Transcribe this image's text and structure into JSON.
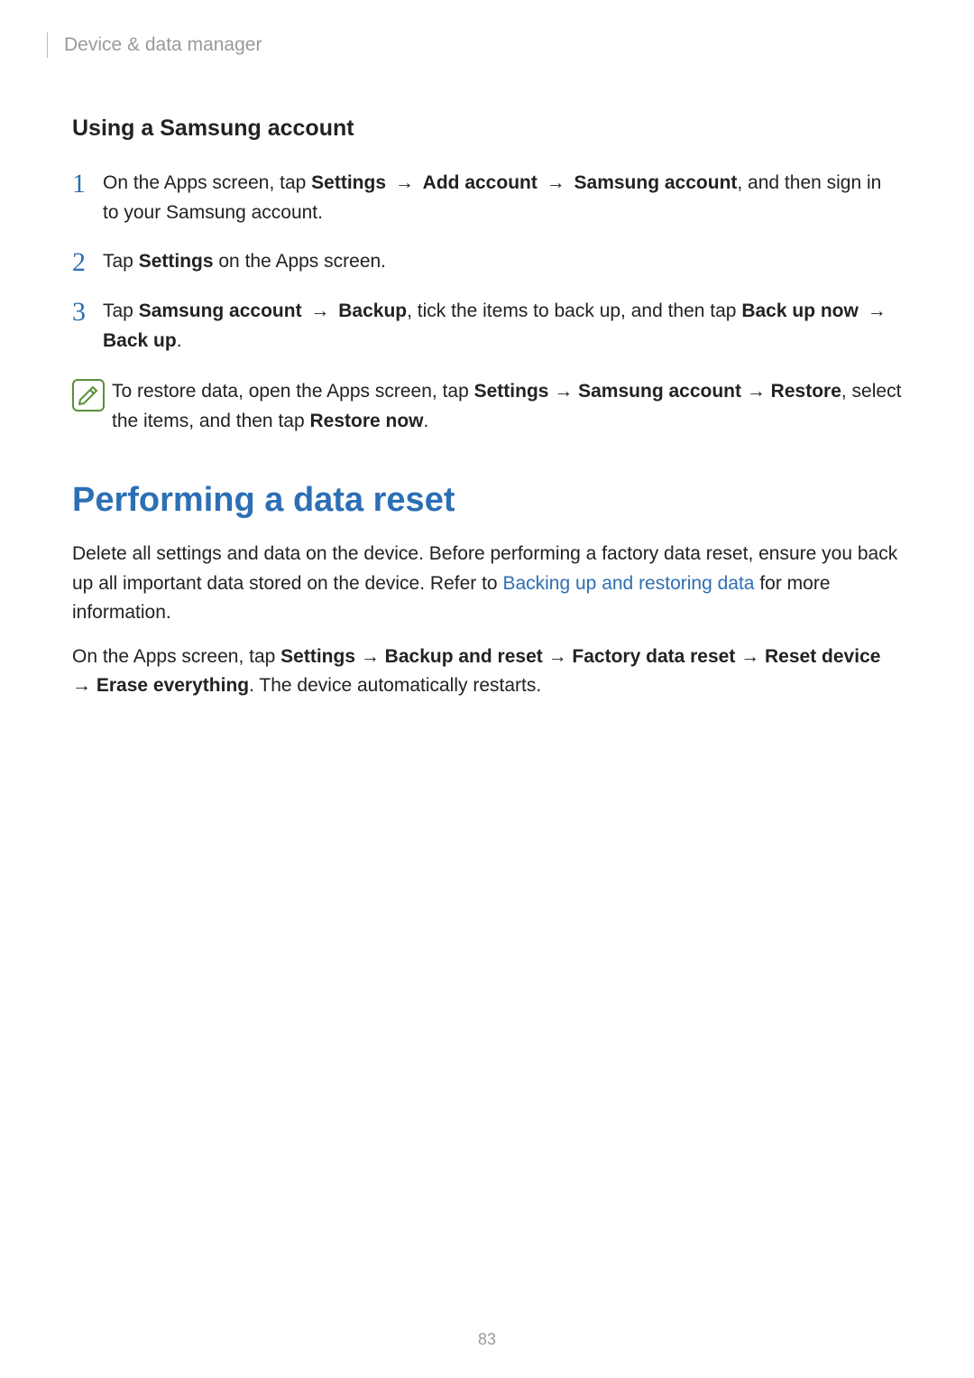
{
  "header": {
    "breadcrumb": "Device & data manager"
  },
  "section1": {
    "heading": "Using a Samsung account",
    "steps": [
      {
        "num": "1",
        "parts": [
          {
            "t": "On the Apps screen, tap "
          },
          {
            "t": "Settings",
            "b": true
          },
          {
            "t": " → ",
            "arrow": true
          },
          {
            "t": "Add account",
            "b": true
          },
          {
            "t": " → ",
            "arrow": true
          },
          {
            "t": "Samsung account",
            "b": true
          },
          {
            "t": ", and then sign in to your Samsung account."
          }
        ]
      },
      {
        "num": "2",
        "parts": [
          {
            "t": "Tap "
          },
          {
            "t": "Settings",
            "b": true
          },
          {
            "t": " on the Apps screen."
          }
        ]
      },
      {
        "num": "3",
        "parts": [
          {
            "t": "Tap "
          },
          {
            "t": "Samsung account",
            "b": true
          },
          {
            "t": " → ",
            "arrow": true
          },
          {
            "t": "Backup",
            "b": true
          },
          {
            "t": ", tick the items to back up, and then tap "
          },
          {
            "t": "Back up now",
            "b": true
          },
          {
            "t": " → ",
            "arrow": true
          },
          {
            "t": "Back up",
            "b": true
          },
          {
            "t": "."
          }
        ]
      }
    ],
    "note": {
      "parts": [
        {
          "t": "To restore data, open the Apps screen, tap "
        },
        {
          "t": "Settings",
          "b": true
        },
        {
          "t": " → ",
          "arrow": true
        },
        {
          "t": "Samsung account",
          "b": true
        },
        {
          "t": " → ",
          "arrow": true
        },
        {
          "t": "Restore",
          "b": true
        },
        {
          "t": ", select the items, and then tap "
        },
        {
          "t": "Restore now",
          "b": true
        },
        {
          "t": "."
        }
      ]
    }
  },
  "section2": {
    "heading": "Performing a data reset",
    "paras": [
      {
        "parts": [
          {
            "t": "Delete all settings and data on the device. Before performing a factory data reset, ensure you back up all important data stored on the device. Refer to "
          },
          {
            "t": "Backing up and restoring data",
            "link": true
          },
          {
            "t": " for more information."
          }
        ]
      },
      {
        "parts": [
          {
            "t": "On the Apps screen, tap "
          },
          {
            "t": "Settings",
            "b": true
          },
          {
            "t": " → ",
            "arrow": true
          },
          {
            "t": "Backup and reset",
            "b": true
          },
          {
            "t": " → ",
            "arrow": true
          },
          {
            "t": "Factory data reset",
            "b": true
          },
          {
            "t": " → ",
            "arrow": true
          },
          {
            "t": "Reset device",
            "b": true
          },
          {
            "t": " → ",
            "arrow": true
          },
          {
            "t": "Erase everything",
            "b": true
          },
          {
            "t": ". The device automatically restarts."
          }
        ]
      }
    ]
  },
  "page_number": "83"
}
